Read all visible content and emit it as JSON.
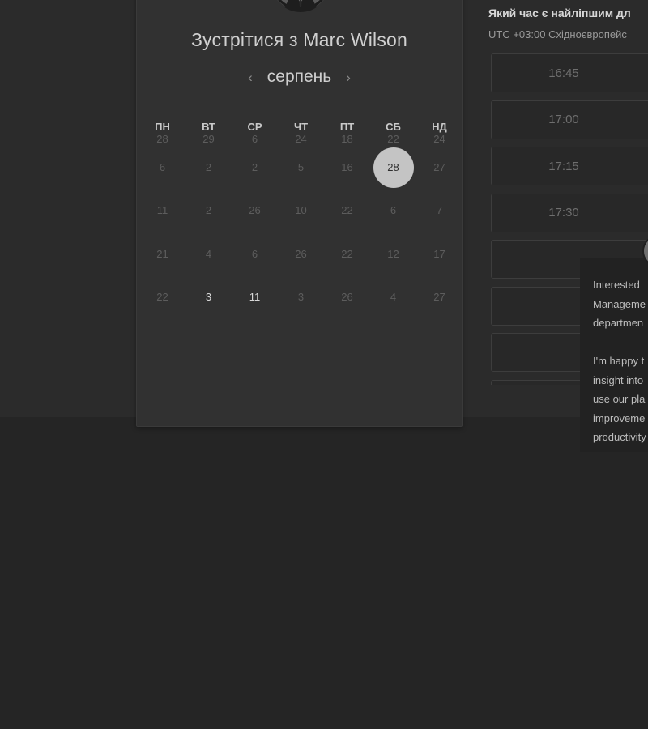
{
  "calendar": {
    "title": "Зустрітися з Marc Wilson",
    "month": "серпень",
    "prev_icon": "‹",
    "next_icon": "›",
    "weekdays": [
      "ПН",
      "ВТ",
      "СР",
      "ЧТ",
      "ПТ",
      "СБ",
      "НД"
    ],
    "weeks": [
      [
        "28",
        "29",
        "6",
        "24",
        "18",
        "22",
        "24"
      ],
      [
        "6",
        "2",
        "2",
        "5",
        "16",
        "28",
        "27"
      ],
      [
        "11",
        "2",
        "26",
        "10",
        "22",
        "6",
        "7"
      ],
      [
        "21",
        "4",
        "6",
        "26",
        "22",
        "12",
        "17"
      ],
      [
        "22",
        "3",
        "11",
        "3",
        "26",
        "4",
        "27"
      ]
    ],
    "selected_day": "28",
    "available_days": [
      "3",
      "11"
    ]
  },
  "times": {
    "heading": "Який час є найліпшим дл",
    "timezone": "UTC +03:00 Східноєвропейс",
    "slots": [
      "16:45",
      "17:00",
      "17:15",
      "17:30",
      "",
      "",
      "",
      ""
    ]
  },
  "chat": {
    "message": "Interested \nManageme\ndepartmen\n\nI'm happy t\ninsight into\nuse our pla\nimproveme\nproductivity"
  },
  "colors": {
    "background": "#252525",
    "card": "#313131",
    "selected": "#c4c4c4"
  }
}
